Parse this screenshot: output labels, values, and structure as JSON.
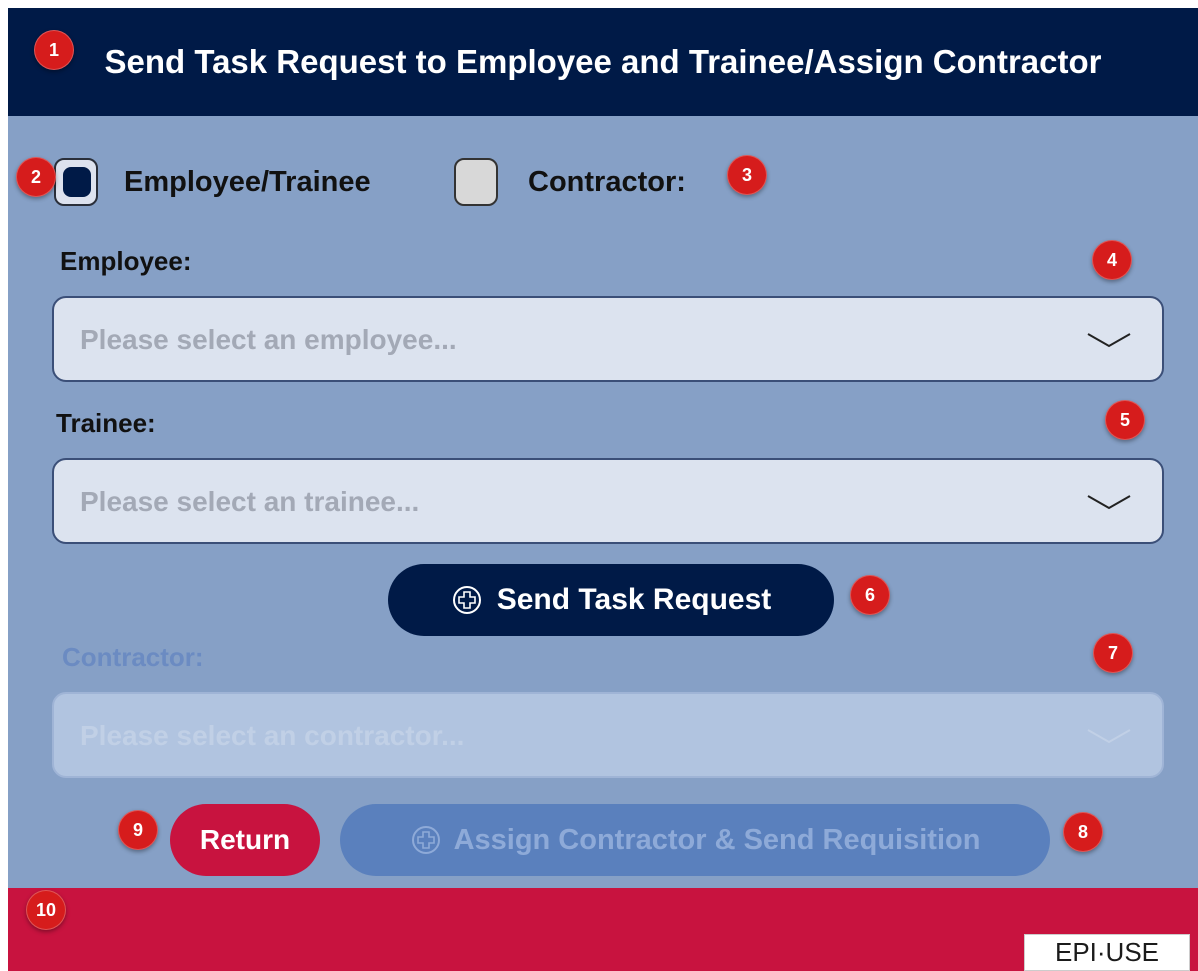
{
  "header": {
    "title": "Send Task Request to Employee and Trainee/Assign Contractor"
  },
  "options": {
    "employee_trainee_label": "Employee/Trainee",
    "employee_trainee_checked": true,
    "contractor_label": "Contractor:",
    "contractor_checked": false
  },
  "employee": {
    "label": "Employee:",
    "placeholder": "Please select an  employee..."
  },
  "trainee": {
    "label": "Trainee:",
    "placeholder": "Please select an  trainee..."
  },
  "send_button": {
    "label": "Send Task Request",
    "icon": "plus-circle-icon"
  },
  "contractor": {
    "label": "Contractor:",
    "placeholder": "Please select an contractor...",
    "disabled": true
  },
  "return_button": {
    "label": "Return"
  },
  "assign_button": {
    "label": "Assign Contractor & Send Requisition",
    "icon": "plus-circle-icon",
    "disabled": true
  },
  "badges": [
    "1",
    "2",
    "3",
    "4",
    "5",
    "6",
    "7",
    "8",
    "9",
    "10"
  ],
  "logo": {
    "text": "EPI·USE"
  },
  "colors": {
    "header_bg": "#001a47",
    "body_bg": "#86a0c6",
    "footer_bg": "#c8133f",
    "badge": "#d61c1c"
  }
}
